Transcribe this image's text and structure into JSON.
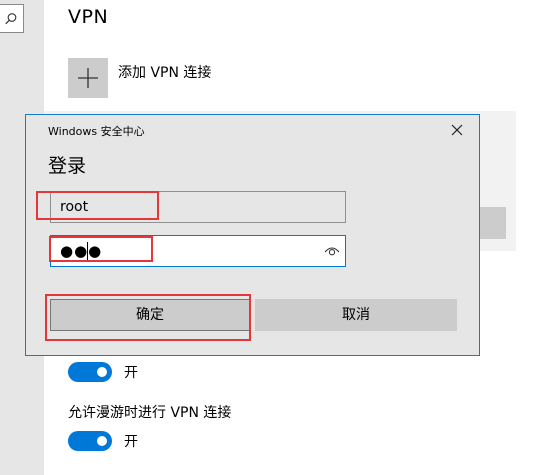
{
  "sidebar": {
    "search_icon": "search-icon"
  },
  "page": {
    "title": "VPN",
    "add_vpn_label": "添加 VPN 连接",
    "roaming_label": "允许漫游时进行 VPN 连接",
    "toggles": [
      {
        "state_label": "开",
        "on": true
      },
      {
        "state_label": "开",
        "on": true
      }
    ]
  },
  "dialog": {
    "caption": "Windows 安全中心",
    "heading": "登录",
    "username_value": "root",
    "password_mask": "●●●",
    "ok_label": "确定",
    "cancel_label": "取消",
    "close_icon": "close-icon",
    "reveal_icon": "eye-icon"
  },
  "colors": {
    "accent": "#0078d7",
    "annotation_box": "#e5363a",
    "toggle_on": "#0078d7"
  }
}
